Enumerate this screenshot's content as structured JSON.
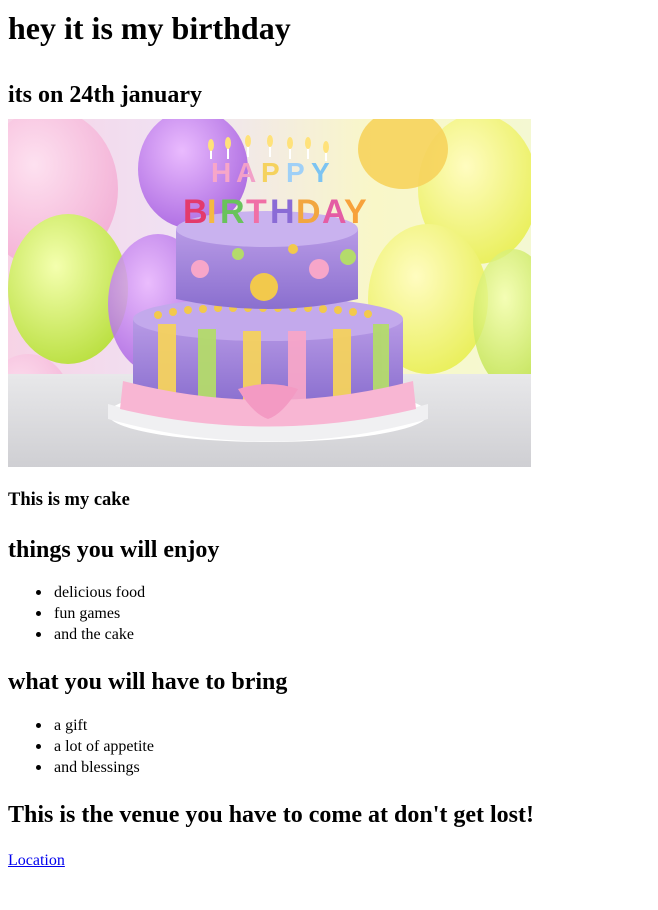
{
  "header": {
    "title": "hey it is my birthday",
    "date_line": "its on 24th january"
  },
  "cake_image": {
    "caption": "This is my cake",
    "topper_text": "HAPPY BIRTHDAY"
  },
  "enjoy": {
    "heading": "things you will enjoy",
    "items": [
      "delicious food",
      "fun games",
      "and the cake"
    ]
  },
  "bring": {
    "heading": "what you will have to bring",
    "items": [
      "a gift",
      "a lot of appetite",
      "and blessings"
    ]
  },
  "venue": {
    "heading": "This is the venue you have to come at don't get lost!",
    "link_label": "Location"
  }
}
